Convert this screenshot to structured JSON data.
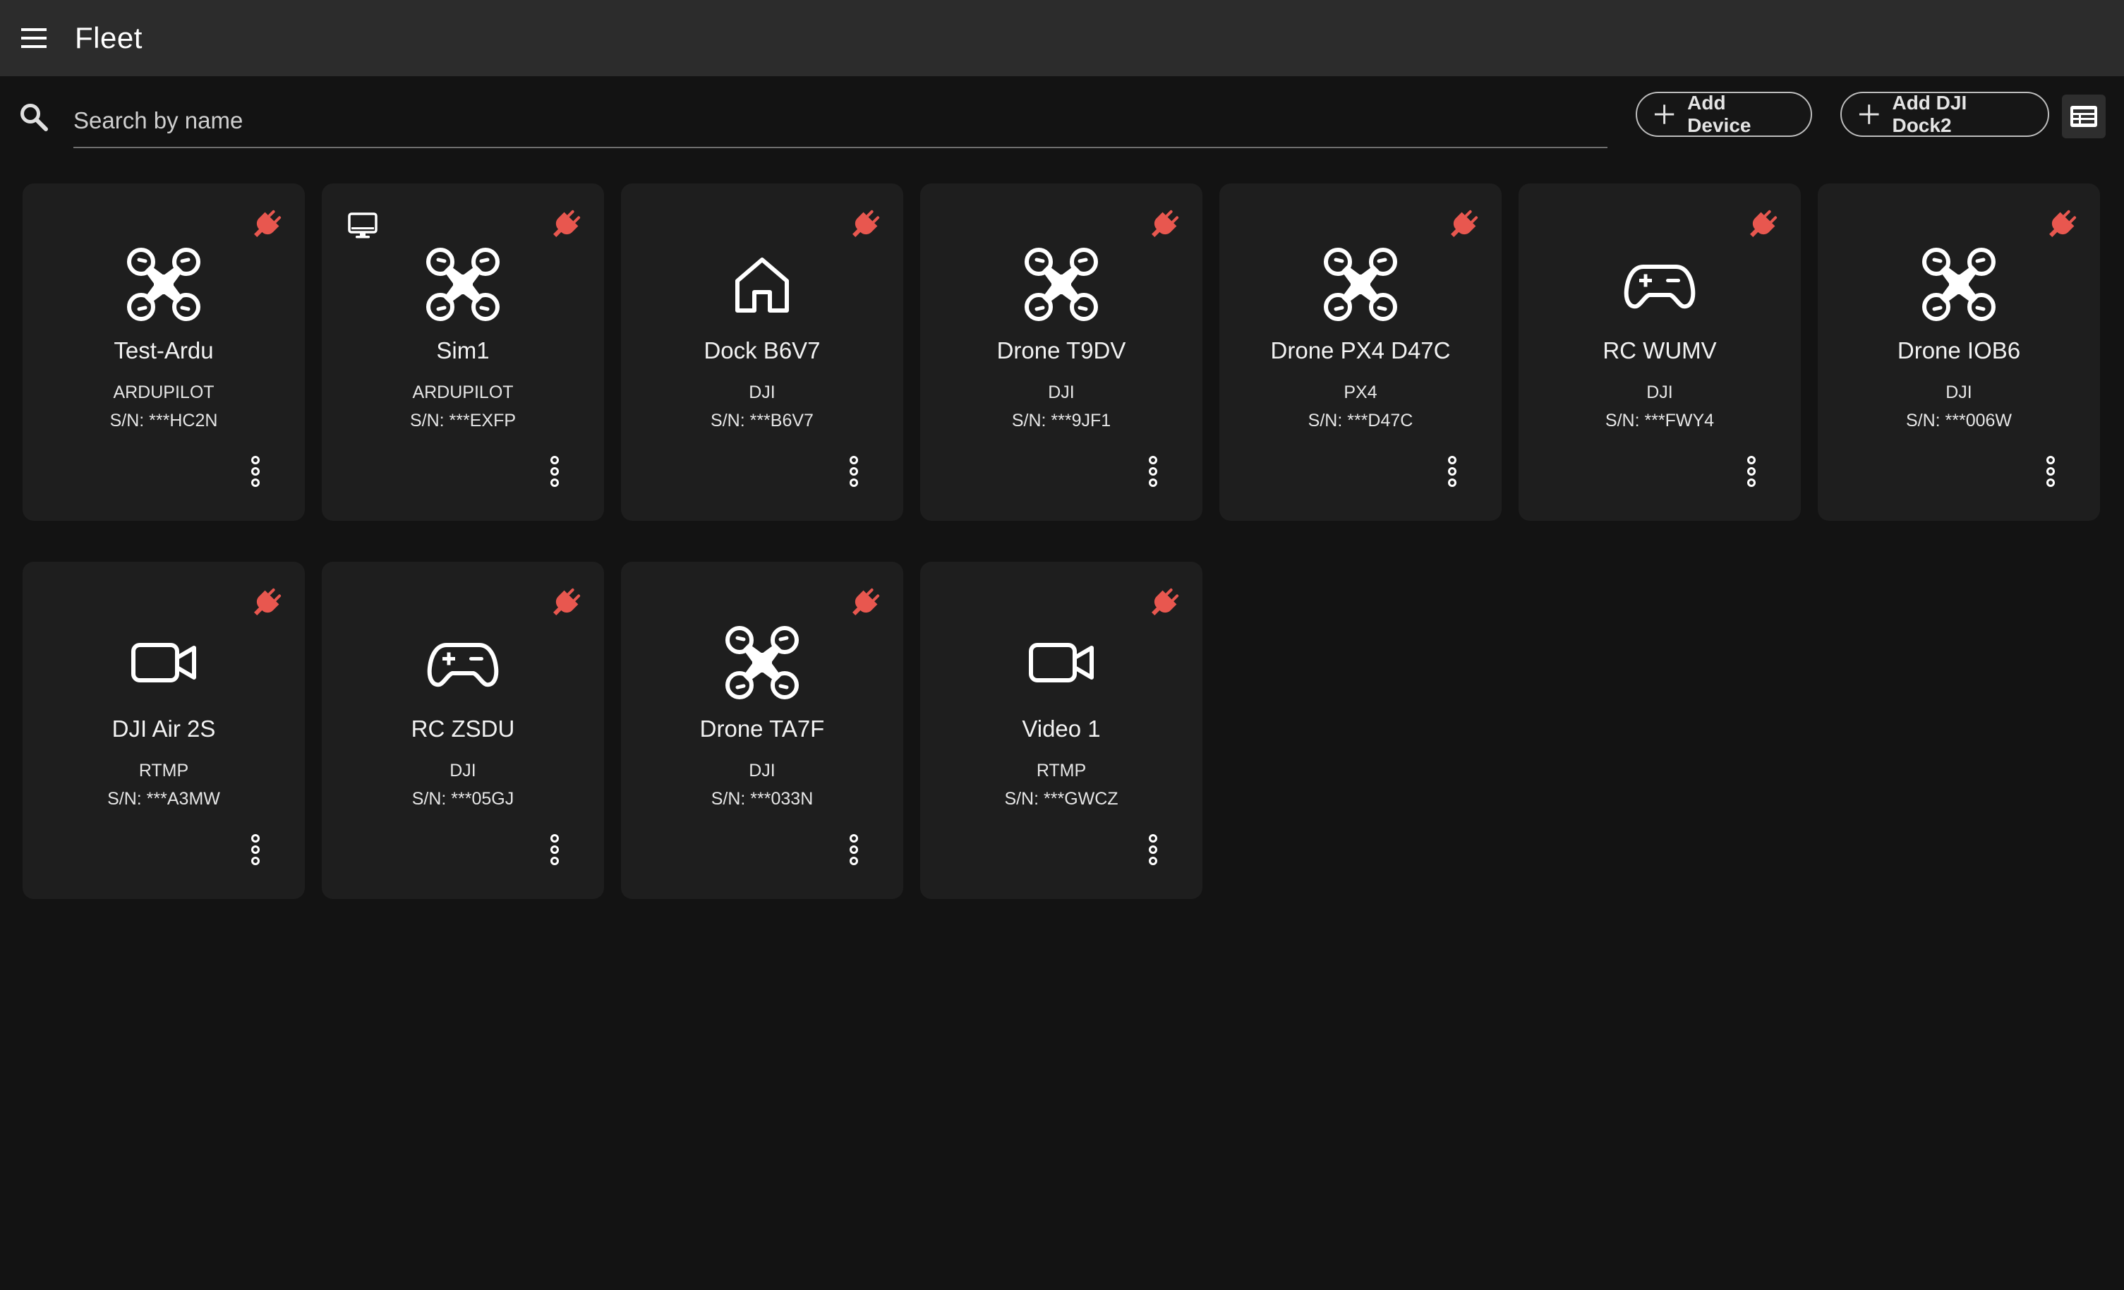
{
  "header": {
    "title": "Fleet",
    "menu_icon": "hamburger-menu-icon"
  },
  "search": {
    "placeholder": "Search by name",
    "value": "",
    "icon": "search-icon"
  },
  "actions": {
    "add_device_label": "Add Device",
    "add_dock_label": "Add DJI Dock2",
    "view_toggle_icon": "table-view-icon"
  },
  "colors": {
    "accent_disconnected": "#e8574f",
    "background": "#131313",
    "card": "#1e1e1e",
    "topbar": "#2c2c2c"
  },
  "devices": [
    {
      "name": "Test-Ardu",
      "type": "ARDUPILOT",
      "sn": "S/N: ***HC2N",
      "icon": "drone-icon",
      "status_icon": "disconnected-plug-icon",
      "simulated": false
    },
    {
      "name": "Sim1",
      "type": "ARDUPILOT",
      "sn": "S/N: ***EXFP",
      "icon": "drone-icon",
      "status_icon": "disconnected-plug-icon",
      "simulated": true
    },
    {
      "name": "Dock B6V7",
      "type": "DJI",
      "sn": "S/N: ***B6V7",
      "icon": "home-icon",
      "status_icon": "disconnected-plug-icon",
      "simulated": false
    },
    {
      "name": "Drone T9DV",
      "type": "DJI",
      "sn": "S/N: ***9JF1",
      "icon": "drone-icon",
      "status_icon": "disconnected-plug-icon",
      "simulated": false
    },
    {
      "name": "Drone PX4 D47C",
      "type": "PX4",
      "sn": "S/N: ***D47C",
      "icon": "drone-icon",
      "status_icon": "disconnected-plug-icon",
      "simulated": false
    },
    {
      "name": "RC WUMV",
      "type": "DJI",
      "sn": "S/N: ***FWY4",
      "icon": "gamepad-icon",
      "status_icon": "disconnected-plug-icon",
      "simulated": false
    },
    {
      "name": "Drone IOB6",
      "type": "DJI",
      "sn": "S/N: ***006W",
      "icon": "drone-icon",
      "status_icon": "disconnected-plug-icon",
      "simulated": false
    },
    {
      "name": "DJI Air 2S",
      "type": "RTMP",
      "sn": "S/N: ***A3MW",
      "icon": "video-camera-icon",
      "status_icon": "disconnected-plug-icon",
      "simulated": false
    },
    {
      "name": "RC ZSDU",
      "type": "DJI",
      "sn": "S/N: ***05GJ",
      "icon": "gamepad-icon",
      "status_icon": "disconnected-plug-icon",
      "simulated": false
    },
    {
      "name": "Drone TA7F",
      "type": "DJI",
      "sn": "S/N: ***033N",
      "icon": "drone-icon",
      "status_icon": "disconnected-plug-icon",
      "simulated": false
    },
    {
      "name": "Video 1",
      "type": "RTMP",
      "sn": "S/N: ***GWCZ",
      "icon": "video-camera-icon",
      "status_icon": "disconnected-plug-icon",
      "simulated": false
    }
  ]
}
